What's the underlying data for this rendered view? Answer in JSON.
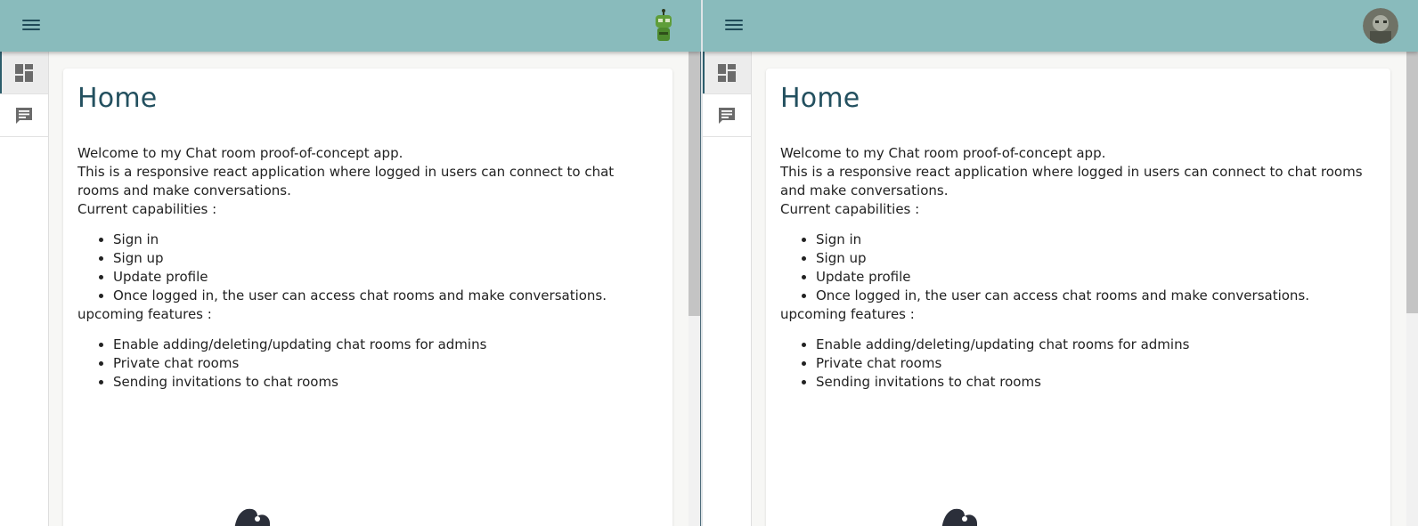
{
  "colors": {
    "appbar": "#89bbbc",
    "heading": "#23505f",
    "icon": "#1f4b58"
  },
  "panes": [
    {
      "appbar": {
        "menu_icon": "hamburger-menu-icon",
        "avatar_icon": "green-robot-avatar-icon"
      },
      "sidebar": {
        "items": [
          {
            "icon": "dashboard-icon",
            "active": true
          },
          {
            "icon": "chat-icon",
            "active": false
          }
        ]
      },
      "home": {
        "title": "Home",
        "intro": [
          "Welcome to my Chat room proof-of-concept app.",
          "This is a responsive react application where logged in users can connect to chat rooms and make conversations.",
          "Current capabilities :"
        ],
        "capabilities": [
          "Sign in",
          "Sign up",
          "Update profile",
          "Once logged in, the user can access chat rooms and make conversations."
        ],
        "upcoming_label": "upcoming features :",
        "upcoming": [
          "Enable adding/deleting/updating chat rooms for admins",
          "Private chat rooms",
          "Sending invitations to chat rooms"
        ]
      }
    },
    {
      "appbar": {
        "menu_icon": "hamburger-menu-icon",
        "avatar_icon": "user-photo-avatar-icon"
      },
      "sidebar": {
        "items": [
          {
            "icon": "dashboard-icon",
            "active": true
          },
          {
            "icon": "chat-icon",
            "active": false
          }
        ]
      },
      "home": {
        "title": "Home",
        "intro": [
          "Welcome to my Chat room proof-of-concept app.",
          "This is a responsive react application where logged in users can connect to chat rooms and make conversations.",
          "Current capabilities :"
        ],
        "capabilities": [
          "Sign in",
          "Sign up",
          "Update profile",
          "Once logged in, the user can access chat rooms and make conversations."
        ],
        "upcoming_label": "upcoming features :",
        "upcoming": [
          "Enable adding/deleting/updating chat rooms for admins",
          "Private chat rooms",
          "Sending invitations to chat rooms"
        ]
      }
    }
  ]
}
